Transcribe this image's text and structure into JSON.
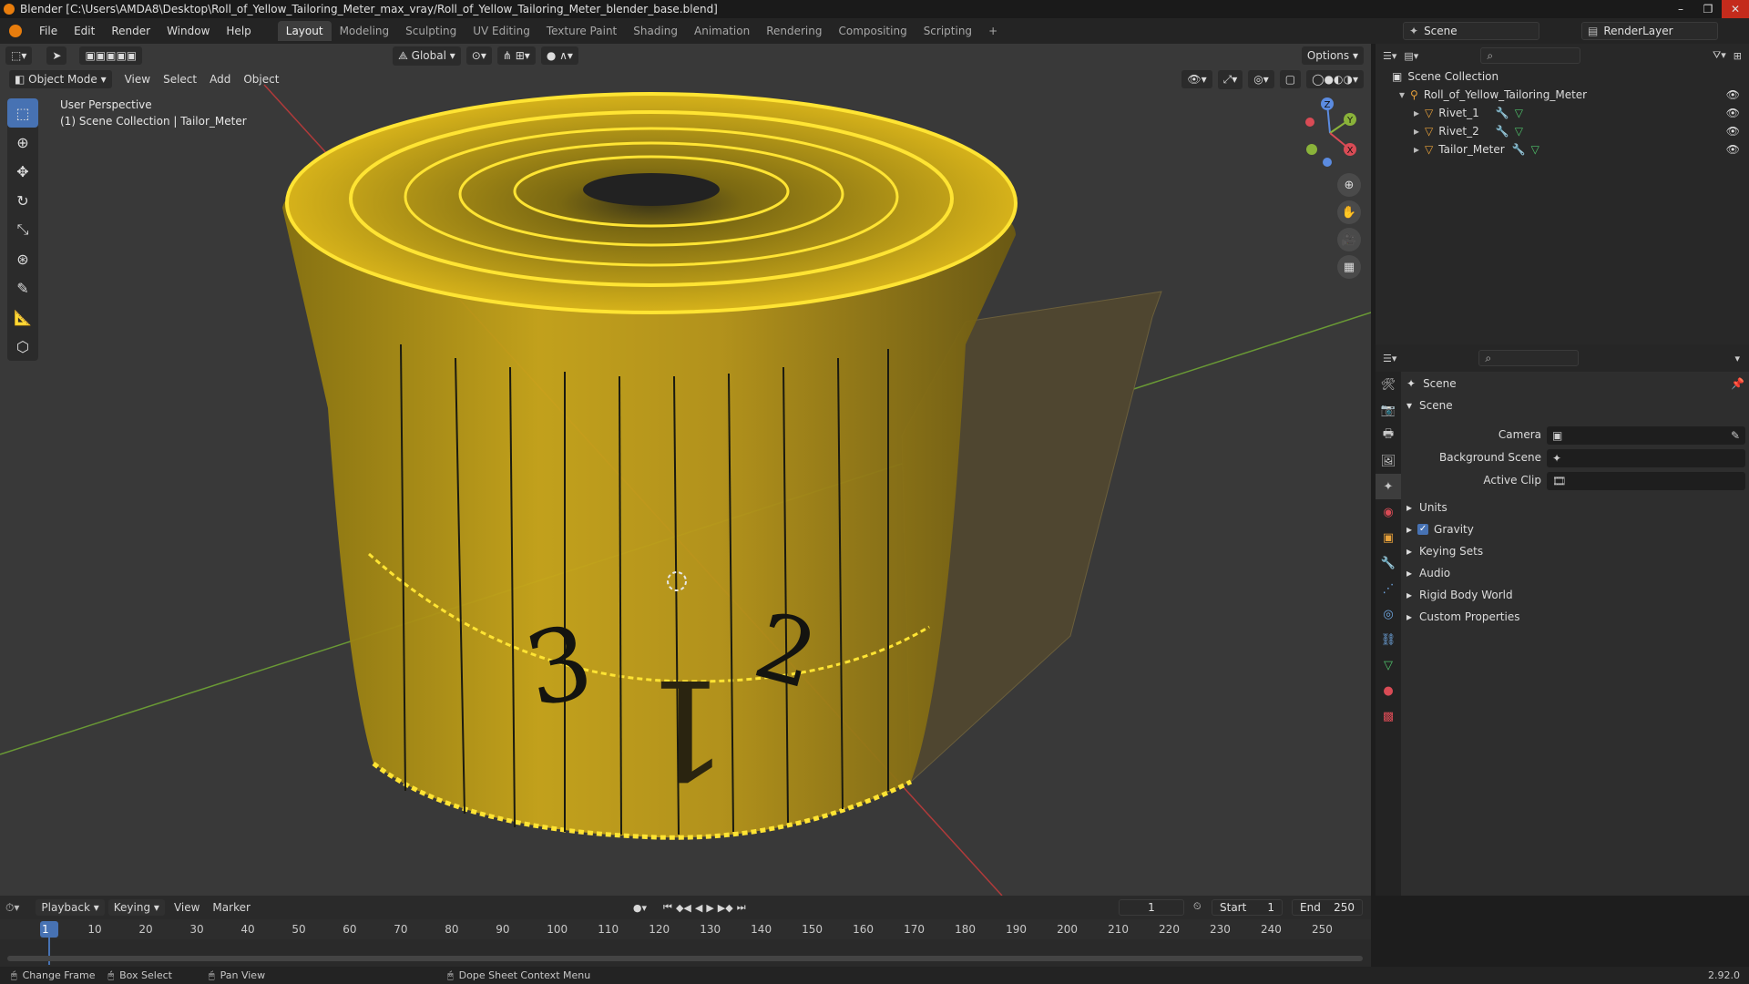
{
  "titlebar": {
    "title": "Blender [C:\\Users\\AMDA8\\Desktop\\Roll_of_Yellow_Tailoring_Meter_max_vray/Roll_of_Yellow_Tailoring_Meter_blender_base.blend]",
    "min": "–",
    "max": "❐",
    "close": "✕"
  },
  "menu": [
    "File",
    "Edit",
    "Render",
    "Window",
    "Help"
  ],
  "workspaces": [
    "Layout",
    "Modeling",
    "Sculpting",
    "UV Editing",
    "Texture Paint",
    "Shading",
    "Animation",
    "Rendering",
    "Compositing",
    "Scripting"
  ],
  "scene_field": "Scene",
  "renderlayer_field": "RenderLayer",
  "viewport": {
    "transform": "Global",
    "options": "Options",
    "mode": "Object Mode",
    "view": "View",
    "select": "Select",
    "add": "Add",
    "object": "Object",
    "perspective": "User Perspective",
    "collection": "(1) Scene Collection | Tailor_Meter",
    "gizmo_z": "Z",
    "gizmo_y": "Y",
    "gizmo_x": "X"
  },
  "outliner": {
    "root": "Scene Collection",
    "items": [
      {
        "label": "Roll_of_Yellow_Tailoring_Meter"
      },
      {
        "label": "Rivet_1"
      },
      {
        "label": "Rivet_2"
      },
      {
        "label": "Tailor_Meter"
      }
    ]
  },
  "properties": {
    "header": "Scene",
    "section": "Scene",
    "camera_label": "Camera",
    "bgscene_label": "Background Scene",
    "activeclip_label": "Active Clip",
    "panels": [
      "Units",
      "Gravity",
      "Keying Sets",
      "Audio",
      "Rigid Body World",
      "Custom Properties"
    ]
  },
  "timeline": {
    "playback": "Playback",
    "keying": "Keying",
    "view": "View",
    "marker": "Marker",
    "current_frame": "1",
    "start_label": "Start",
    "start": "1",
    "end_label": "End",
    "end": "250",
    "ticks": [
      "1",
      "10",
      "20",
      "30",
      "40",
      "50",
      "60",
      "70",
      "80",
      "90",
      "100",
      "110",
      "120",
      "130",
      "140",
      "150",
      "160",
      "170",
      "180",
      "190",
      "200",
      "210",
      "220",
      "230",
      "240",
      "250"
    ]
  },
  "statusbar": {
    "change_frame": "Change Frame",
    "box_select": "Box Select",
    "pan_view": "Pan View",
    "context_menu": "Dope Sheet Context Menu",
    "version": "2.92.0"
  },
  "colors": {
    "accent": "#4772b3",
    "tape": "#e8c21a",
    "tape_edge": "#ffe433"
  }
}
